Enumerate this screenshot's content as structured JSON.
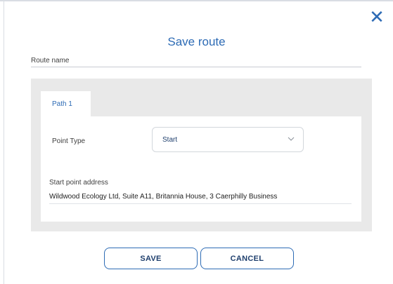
{
  "dialog": {
    "title": "Save route",
    "close_icon": "close-icon"
  },
  "route_name": {
    "label": "Route name",
    "value": ""
  },
  "tabs": [
    {
      "label": "Path 1",
      "selected": true
    }
  ],
  "point_type": {
    "label": "Point Type",
    "selected": "Start",
    "chevron_icon": "chevron-down-icon"
  },
  "start_address": {
    "label": "Start point address",
    "value": "Wildwood Ecology Ltd, Suite A11, Britannia House, 3 Caerphilly Business"
  },
  "buttons": {
    "save": "SAVE",
    "cancel": "CANCEL"
  },
  "colors": {
    "accent": "#2d6bb5",
    "panel_bg": "#e9e9e9"
  }
}
